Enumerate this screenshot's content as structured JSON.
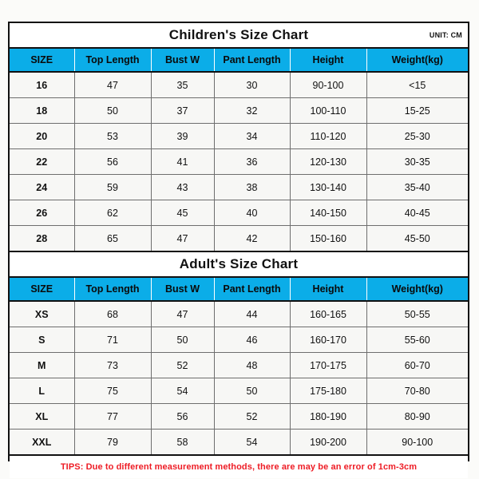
{
  "unit_note": "UNIT: CM",
  "columns": [
    "SIZE",
    "Top Length",
    "Bust W",
    "Pant Length",
    "Height",
    "Weight(kg)"
  ],
  "children": {
    "title": "Children's Size Chart",
    "headers": {
      "size": "SIZE",
      "top_length": "Top Length",
      "bust_w": "Bust W",
      "pant_length": "Pant Length",
      "height": "Height",
      "weight": "Weight(kg)"
    },
    "rows": [
      {
        "size": "16",
        "top_length": "47",
        "bust_w": "35",
        "pant_length": "30",
        "height": "90-100",
        "weight": "<15"
      },
      {
        "size": "18",
        "top_length": "50",
        "bust_w": "37",
        "pant_length": "32",
        "height": "100-110",
        "weight": "15-25"
      },
      {
        "size": "20",
        "top_length": "53",
        "bust_w": "39",
        "pant_length": "34",
        "height": "110-120",
        "weight": "25-30"
      },
      {
        "size": "22",
        "top_length": "56",
        "bust_w": "41",
        "pant_length": "36",
        "height": "120-130",
        "weight": "30-35"
      },
      {
        "size": "24",
        "top_length": "59",
        "bust_w": "43",
        "pant_length": "38",
        "height": "130-140",
        "weight": "35-40"
      },
      {
        "size": "26",
        "top_length": "62",
        "bust_w": "45",
        "pant_length": "40",
        "height": "140-150",
        "weight": "40-45"
      },
      {
        "size": "28",
        "top_length": "65",
        "bust_w": "47",
        "pant_length": "42",
        "height": "150-160",
        "weight": "45-50"
      }
    ]
  },
  "adults": {
    "title": "Adult's Size Chart",
    "headers": {
      "size": "SIZE",
      "top_length": "Top Length",
      "bust_w": "Bust W",
      "pant_length": "Pant Length",
      "height": "Height",
      "weight": "Weight(kg)"
    },
    "rows": [
      {
        "size": "XS",
        "top_length": "68",
        "bust_w": "47",
        "pant_length": "44",
        "height": "160-165",
        "weight": "50-55"
      },
      {
        "size": "S",
        "top_length": "71",
        "bust_w": "50",
        "pant_length": "46",
        "height": "160-170",
        "weight": "55-60"
      },
      {
        "size": "M",
        "top_length": "73",
        "bust_w": "52",
        "pant_length": "48",
        "height": "170-175",
        "weight": "60-70"
      },
      {
        "size": "L",
        "top_length": "75",
        "bust_w": "54",
        "pant_length": "50",
        "height": "175-180",
        "weight": "70-80"
      },
      {
        "size": "XL",
        "top_length": "77",
        "bust_w": "56",
        "pant_length": "52",
        "height": "180-190",
        "weight": "80-90"
      },
      {
        "size": "XXL",
        "top_length": "79",
        "bust_w": "58",
        "pant_length": "54",
        "height": "190-200",
        "weight": "90-100"
      }
    ]
  },
  "tips": "TIPS: Due to different measurement methods, there are may be an error of 1cm-3cm",
  "colors": {
    "header_blue": "#0bade8",
    "tips_red": "#ee1c25",
    "border_dark": "#111111",
    "border_light": "#6e6e6e",
    "row_background": "#f7f7f5",
    "page_background": "#fbfbf9"
  }
}
